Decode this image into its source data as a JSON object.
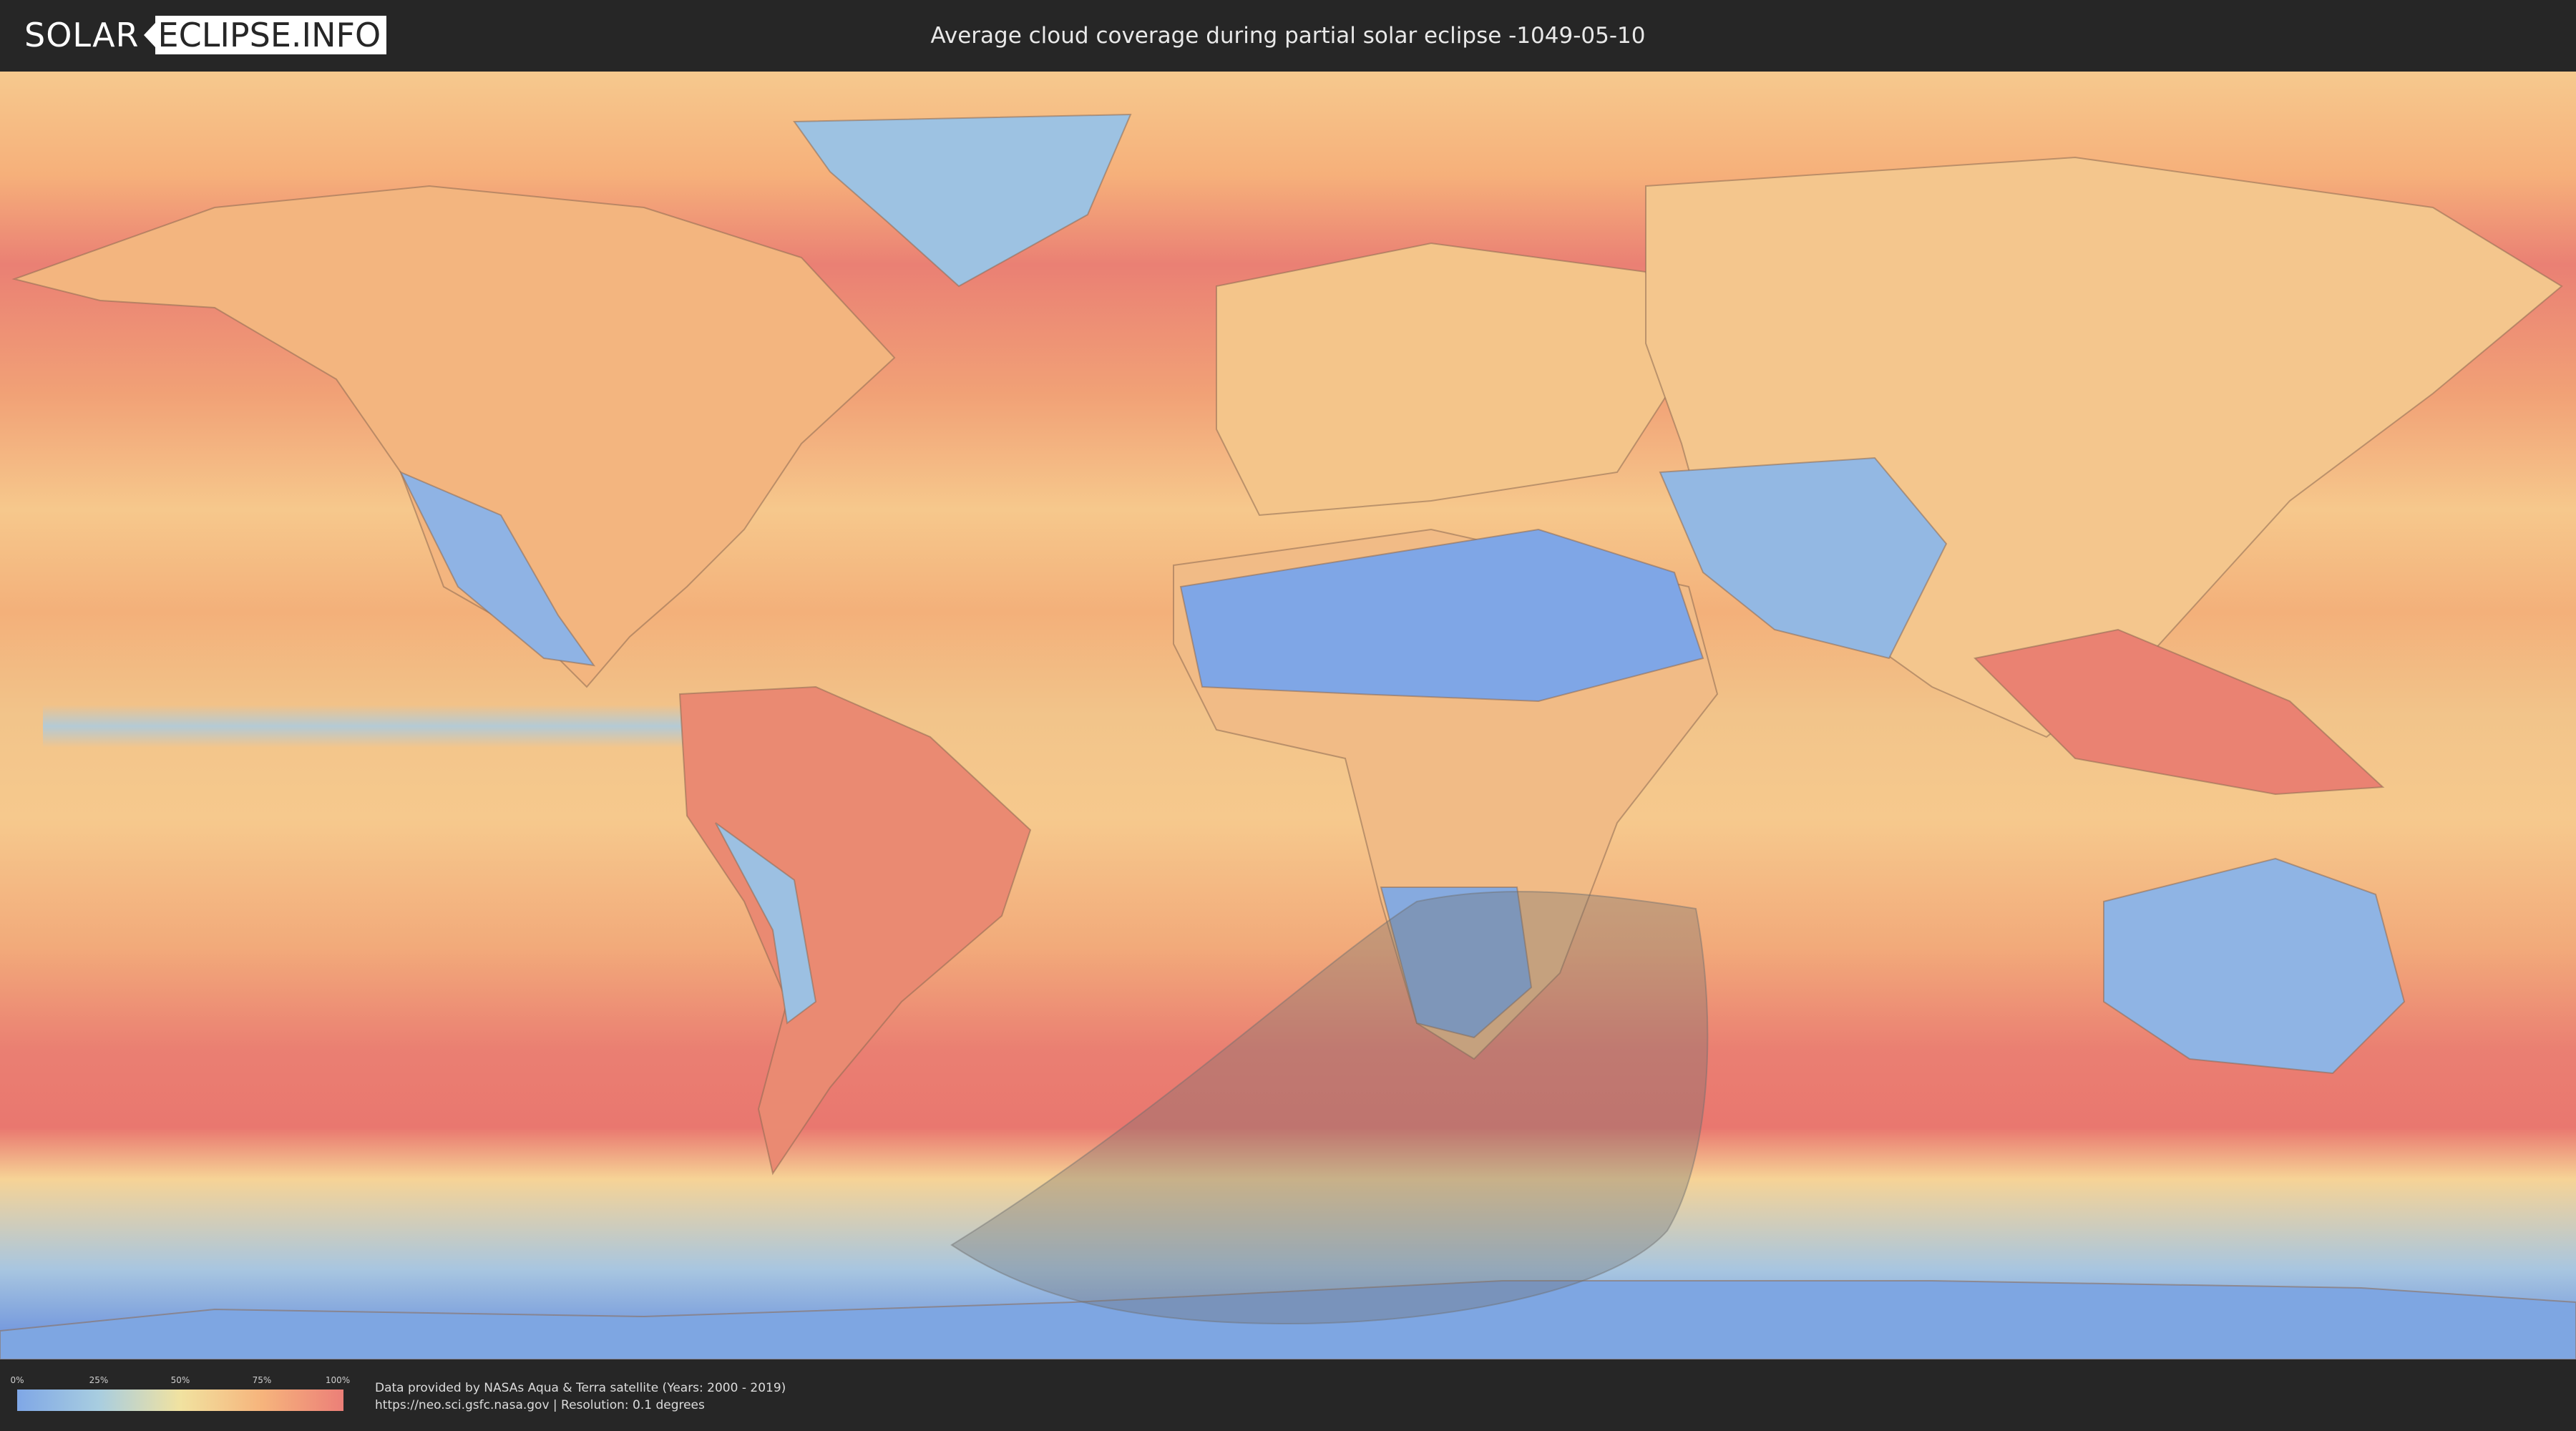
{
  "header": {
    "logo_left": "SOLAR",
    "logo_right": "ECLIPSE.INFO",
    "title": "Average cloud coverage during partial solar eclipse -1049-05-10"
  },
  "legend": {
    "ticks": [
      "0%",
      "25%",
      "50%",
      "75%",
      "100%"
    ],
    "colors": [
      "#7fa7e6",
      "#a8cde0",
      "#f1e2a0",
      "#f6b47c",
      "#ec7f78"
    ]
  },
  "credits": {
    "line1": "Data provided by NASAs Aqua & Terra satellite (Years: 2000 - 2019)",
    "line2": "https://neo.sci.gsfc.nasa.gov | Resolution: 0.1 degrees"
  },
  "map": {
    "projection": "equirectangular",
    "eclipse_region_color": "#6e6e6e",
    "ocean_color": "#f2a070",
    "clear_sky_color": "#7ea6e2",
    "antarctica_color": "#6f96e0"
  }
}
